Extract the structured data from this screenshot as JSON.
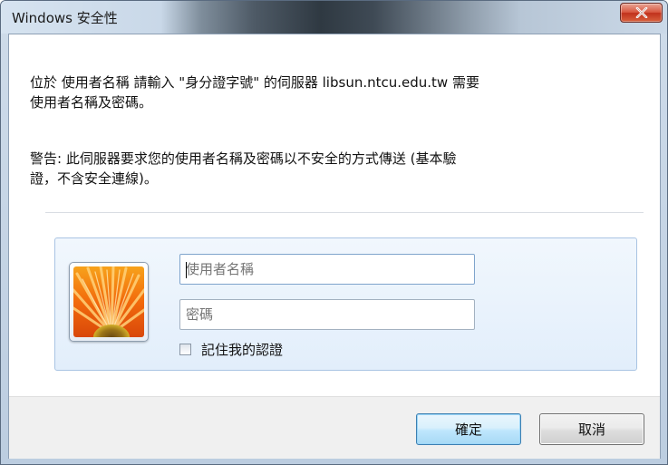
{
  "window": {
    "title": "Windows 安全性"
  },
  "message": {
    "line1": "位於 使用者名稱 請輸入 \"身分證字號\" 的伺服器 libsun.ntcu.edu.tw 需要\n使用者名稱及密碼。",
    "warning": "警告: 此伺服器要求您的使用者名稱及密碼以不安全的方式傳送 (基本驗\n證，不含安全連線)。"
  },
  "credentials": {
    "avatar_icon": "user-tile-flower-icon",
    "username_placeholder": "使用者名稱",
    "username_value": "",
    "password_placeholder": "密碼",
    "password_value": "",
    "remember_label": "記住我的認證",
    "remember_checked": false
  },
  "buttons": {
    "ok_label": "確定",
    "cancel_label": "取消"
  },
  "colors": {
    "close_button": "#c7422a",
    "panel_border": "#a9c4e3",
    "ok_border": "#3c7fb1"
  }
}
